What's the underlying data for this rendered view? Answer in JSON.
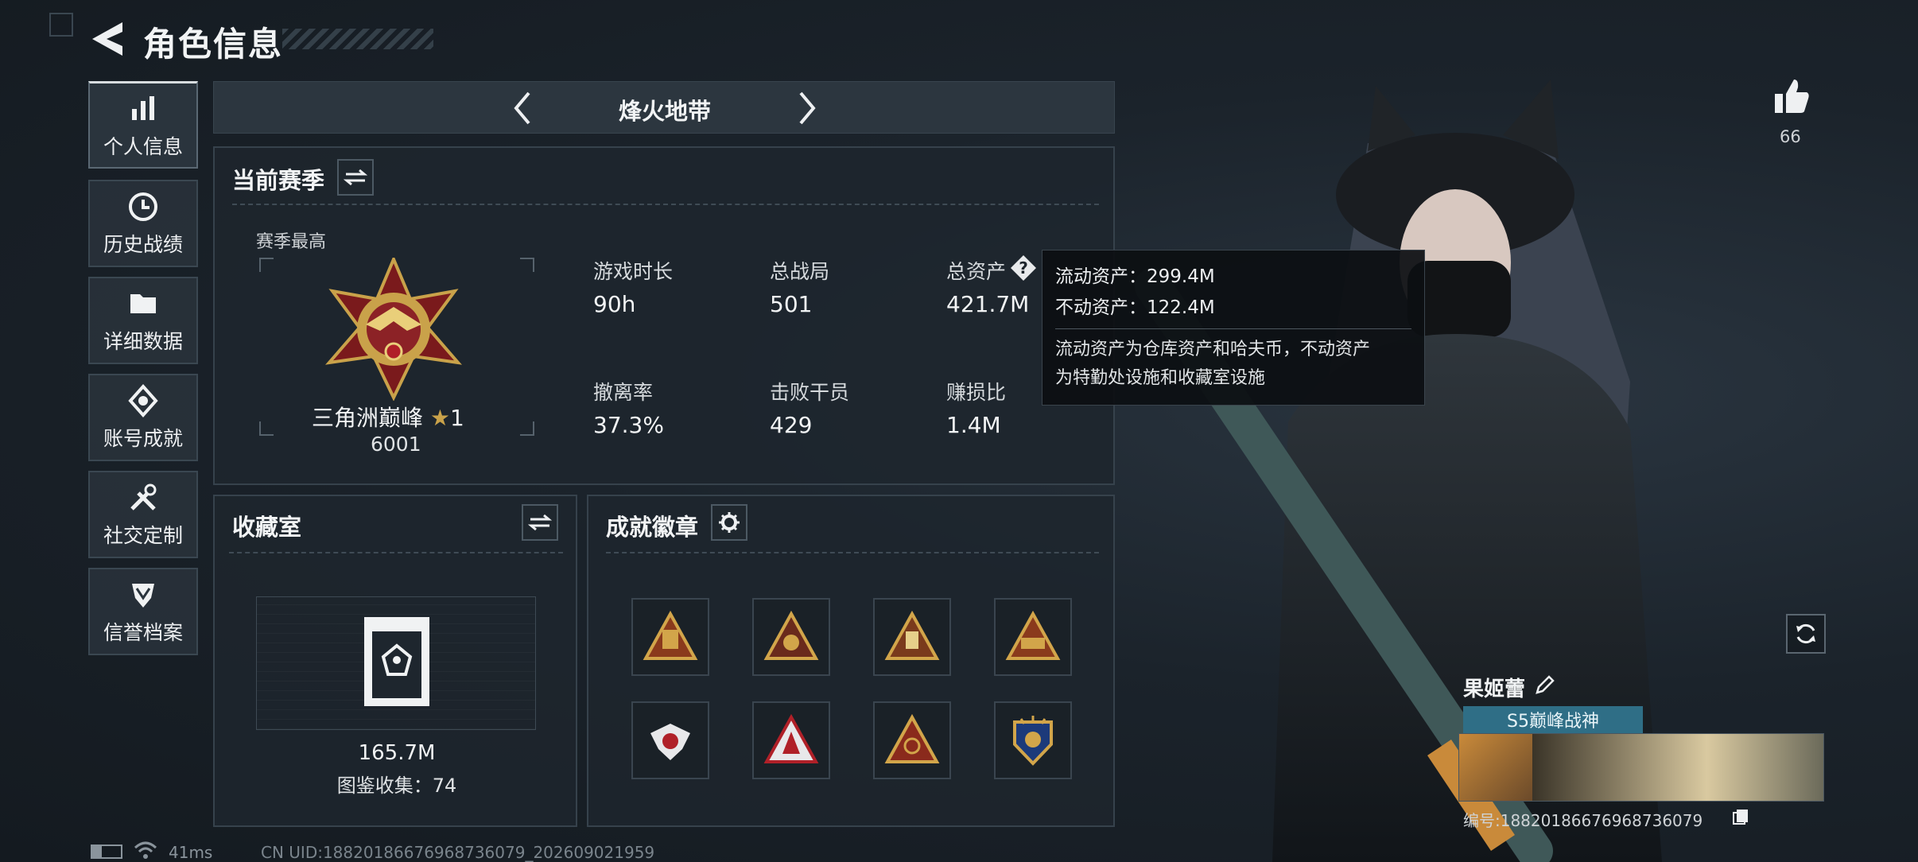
{
  "header": {
    "title": "角色信息"
  },
  "nav": {
    "items": [
      {
        "label": "个人信息",
        "icon": "bar-chart-icon",
        "active": true
      },
      {
        "label": "历史战绩",
        "icon": "history-clock-icon",
        "active": false
      },
      {
        "label": "详细数据",
        "icon": "folder-icon",
        "active": false
      },
      {
        "label": "账号成就",
        "icon": "achievement-icon",
        "active": false
      },
      {
        "label": "社交定制",
        "icon": "tools-icon",
        "active": false
      },
      {
        "label": "信誉档案",
        "icon": "shield-icon",
        "active": false
      }
    ]
  },
  "mode": {
    "label": "烽火地带"
  },
  "season": {
    "title": "当前赛季",
    "best_label": "赛季最高",
    "rank_name": "三角洲巅峰",
    "rank_stars": "1",
    "rank_score": "6001",
    "stats": [
      {
        "label": "游戏时长",
        "value": "90h"
      },
      {
        "label": "总战局",
        "value": "501"
      },
      {
        "label": "总资产",
        "value": "421.7M"
      },
      {
        "label": "撤离率",
        "value": "37.3%"
      },
      {
        "label": "击败干员",
        "value": "429"
      },
      {
        "label": "赚损比",
        "value": "1.4M"
      }
    ]
  },
  "tooltip": {
    "liquid": "流动资产：299.4M",
    "fixed": "不动资产：122.4M",
    "desc_line1": "流动资产为仓库资产和哈夫币，不动资产",
    "desc_line2": "为特勤处设施和收藏室设施"
  },
  "collection": {
    "title": "收藏室",
    "value": "165.7M",
    "codex": "图鉴收集：74"
  },
  "badges": {
    "title": "成就徽章",
    "items": [
      "badge-1",
      "badge-2",
      "badge-3",
      "badge-4",
      "badge-5",
      "badge-6",
      "badge-7",
      "badge-8"
    ]
  },
  "like": {
    "count": "66"
  },
  "player": {
    "name": "果姬蕾",
    "title_badge": "S5巅峰战神",
    "id_line": "编号:18820186676968736079"
  },
  "footer": {
    "ping": "41ms",
    "uid": "CN UID:18820186676968736079_202609021959"
  },
  "colors": {
    "background": "#1b232b",
    "panel": "#1e262e",
    "accent_gold": "#c9a24a",
    "badge_title_bg": "#2f6e86"
  }
}
